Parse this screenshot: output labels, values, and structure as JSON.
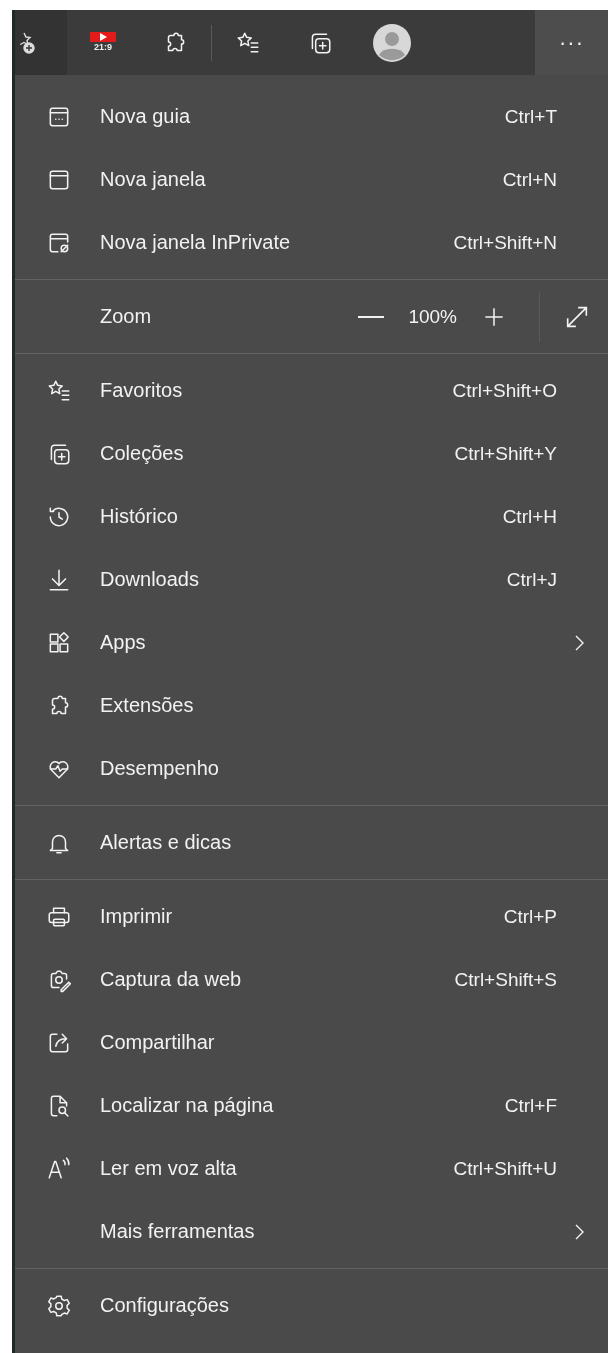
{
  "toolbar": {
    "badge_text": "21:9",
    "more_button": {
      "label": "···",
      "selected": true
    }
  },
  "menu": {
    "sections": [
      {
        "items": [
          {
            "kind": "item",
            "label": "Nova guia",
            "shortcut": "Ctrl+T"
          },
          {
            "kind": "item",
            "label": "Nova janela",
            "shortcut": "Ctrl+N"
          },
          {
            "kind": "item",
            "label": "Nova janela InPrivate",
            "shortcut": "Ctrl+Shift+N"
          }
        ]
      },
      {
        "items": [
          {
            "kind": "zoom",
            "label": "Zoom",
            "value": "100%"
          }
        ]
      },
      {
        "items": [
          {
            "kind": "item",
            "label": "Favoritos",
            "shortcut": "Ctrl+Shift+O"
          },
          {
            "kind": "item",
            "label": "Coleções",
            "shortcut": "Ctrl+Shift+Y"
          },
          {
            "kind": "item",
            "label": "Histórico",
            "shortcut": "Ctrl+H"
          },
          {
            "kind": "item",
            "label": "Downloads",
            "shortcut": "Ctrl+J"
          },
          {
            "kind": "submenu",
            "label": "Apps"
          },
          {
            "kind": "item",
            "label": "Extensões"
          },
          {
            "kind": "item",
            "label": "Desempenho"
          }
        ]
      },
      {
        "items": [
          {
            "kind": "item",
            "label": "Alertas e dicas"
          }
        ]
      },
      {
        "items": [
          {
            "kind": "item",
            "label": "Imprimir",
            "shortcut": "Ctrl+P"
          },
          {
            "kind": "item",
            "label": "Captura da web",
            "shortcut": "Ctrl+Shift+S"
          },
          {
            "kind": "item",
            "label": "Compartilhar"
          },
          {
            "kind": "item",
            "label": "Localizar na página",
            "shortcut": "Ctrl+F"
          },
          {
            "kind": "item",
            "label": "Ler em voz alta",
            "shortcut": "Ctrl+Shift+U"
          },
          {
            "kind": "submenu",
            "label": "Mais ferramentas"
          }
        ]
      },
      {
        "items": [
          {
            "kind": "item",
            "label": "Configurações"
          }
        ]
      }
    ]
  }
}
